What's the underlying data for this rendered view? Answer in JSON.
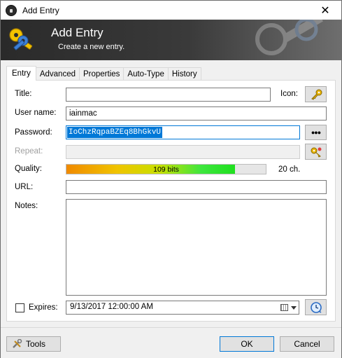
{
  "window": {
    "title": "Add Entry",
    "close_glyph": "✕"
  },
  "banner": {
    "title": "Add Entry",
    "subtitle": "Create a new entry."
  },
  "tabs": [
    {
      "label": "Entry",
      "active": true
    },
    {
      "label": "Advanced",
      "active": false
    },
    {
      "label": "Properties",
      "active": false
    },
    {
      "label": "Auto-Type",
      "active": false
    },
    {
      "label": "History",
      "active": false
    }
  ],
  "form": {
    "title_label": "Title:",
    "title_value": "",
    "icon_label": "Icon:",
    "username_label": "User name:",
    "username_value": "iainmac",
    "password_label": "Password:",
    "password_value": "IoChzRqpaBZEq8BhGkvU",
    "show_password_glyph": "●●●",
    "repeat_label": "Repeat:",
    "repeat_value": "",
    "quality_label": "Quality:",
    "quality_text": "109 bits",
    "quality_fraction": 0.845,
    "quality_chars": "20 ch.",
    "url_label": "URL:",
    "url_value": "",
    "notes_label": "Notes:",
    "notes_value": "",
    "expires_label": "Expires:",
    "expires_checked": false,
    "expires_value": "9/13/2017 12:00:00 AM"
  },
  "buttons": {
    "tools": "Tools",
    "ok": "OK",
    "cancel": "Cancel"
  },
  "colors": {
    "accent": "#0078d7",
    "banner_dark": "#2a2a2a",
    "key_gold": "#e8b400"
  }
}
